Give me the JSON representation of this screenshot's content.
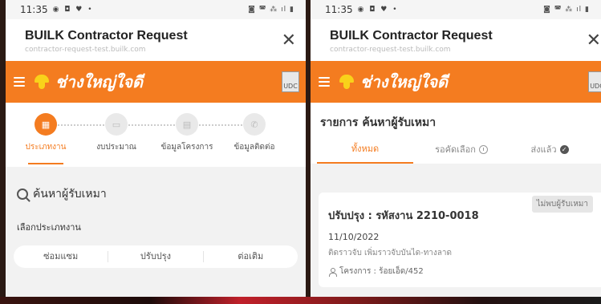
{
  "status": {
    "time": "11:35",
    "icons": "◉ ◘ ♥ •",
    "right": "◙ ◚ ⁂ ıl ▮"
  },
  "header": {
    "title": "BUILK Contractor Request",
    "url": "contractor-request-test.builk.com"
  },
  "brand": {
    "logo_text": "ช่างใหญ่ใจดี",
    "partner": "UDC"
  },
  "left": {
    "steps": [
      {
        "label": "ประเภทงาน"
      },
      {
        "label": "งบประมาณ"
      },
      {
        "label": "ข้อมูลโครงการ"
      },
      {
        "label": "ข้อมูลติดต่อ"
      }
    ],
    "search_label": "ค้นหาผู้รับเหมา",
    "field_label": "เลือกประเภทงาน",
    "options": [
      "ซ่อมแซม",
      "ปรับปรุง",
      "ต่อเติม"
    ]
  },
  "right": {
    "list_title": "รายการ ค้นหาผู้รับเหมา",
    "tabs": [
      "ทั้งหมด",
      "รอคัดเลือก",
      "ส่งแล้ว"
    ],
    "card": {
      "badge": "ไม่พบผู้รับเหมา",
      "title": "ปรับปรุง : รหัสงาน 2210-0018",
      "date": "11/10/2022",
      "desc": "ติดราวจับ เพิ่มราวจับบันได-ทางลาด",
      "project": "โครงการ : ร้อยเอ็ด/452"
    }
  },
  "colors": {
    "accent": "#f47c20",
    "helmet": "#f9d21a"
  }
}
